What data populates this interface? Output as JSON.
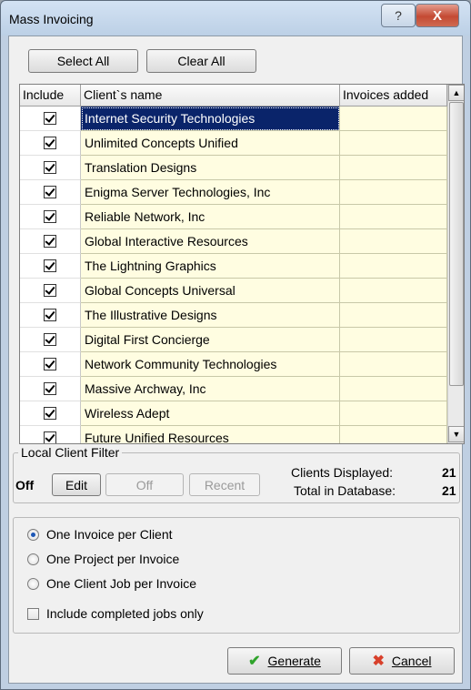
{
  "window": {
    "title": "Mass Invoicing",
    "help_glyph": "?",
    "close_glyph": "X"
  },
  "toolbar": {
    "select_all": "Select All",
    "clear_all": "Clear All"
  },
  "grid": {
    "columns": [
      "Include",
      "Client`s name",
      "Invoices added"
    ],
    "rows": [
      {
        "include": true,
        "name": "Internet Security Technologies",
        "invoices": ""
      },
      {
        "include": true,
        "name": "Unlimited Concepts Unified",
        "invoices": ""
      },
      {
        "include": true,
        "name": "Translation Designs",
        "invoices": ""
      },
      {
        "include": true,
        "name": "Enigma Server Technologies, Inc",
        "invoices": ""
      },
      {
        "include": true,
        "name": "Reliable Network, Inc",
        "invoices": ""
      },
      {
        "include": true,
        "name": "Global Interactive Resources",
        "invoices": ""
      },
      {
        "include": true,
        "name": "The Lightning Graphics",
        "invoices": ""
      },
      {
        "include": true,
        "name": "Global Concepts Universal",
        "invoices": ""
      },
      {
        "include": true,
        "name": "The Illustrative Designs",
        "invoices": ""
      },
      {
        "include": true,
        "name": "Digital First Concierge",
        "invoices": ""
      },
      {
        "include": true,
        "name": "Network Community Technologies",
        "invoices": ""
      },
      {
        "include": true,
        "name": "Massive Archway, Inc",
        "invoices": ""
      },
      {
        "include": true,
        "name": "Wireless Adept",
        "invoices": ""
      },
      {
        "include": true,
        "name": "Future Unified Resources",
        "invoices": ""
      }
    ]
  },
  "filter": {
    "legend": "Local Client Filter",
    "state": "Off",
    "edit_label": "Edit",
    "off_label": "Off",
    "recent_label": "Recent",
    "clients_displayed_label": "Clients Displayed:",
    "clients_displayed_value": "21",
    "total_label": "Total in Database:",
    "total_value": "21"
  },
  "options": {
    "radios": [
      {
        "label": "One Invoice per Client",
        "checked": true
      },
      {
        "label": "One Project per Invoice",
        "checked": false
      },
      {
        "label": "One Client Job per Invoice",
        "checked": false
      }
    ],
    "completed_only_label": "Include completed jobs only",
    "completed_only_checked": false
  },
  "actions": {
    "generate_label": "Generate",
    "cancel_label": "Cancel"
  },
  "colors": {
    "selection": "#0a246a",
    "row_background": "#fffde1",
    "generate_icon": "#2fa32b",
    "cancel_icon": "#d8402b"
  }
}
